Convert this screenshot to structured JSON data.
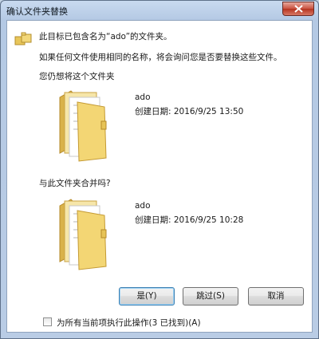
{
  "window": {
    "title": "确认文件夹替换"
  },
  "message": {
    "headline": "此目标已包含名为“ado”的文件夹。",
    "detail": "如果任何文件使用相同的名称，将会询问您是否要替换这些文件。",
    "prompt_move": "您仍想将这个文件夹",
    "prompt_merge": "与此文件夹合并吗?"
  },
  "source_folder": {
    "name": "ado",
    "created": "创建日期: 2016/9/25 13:50"
  },
  "target_folder": {
    "name": "ado",
    "created": "创建日期: 2016/9/25 10:28"
  },
  "buttons": {
    "yes": "是(Y)",
    "skip": "跳过(S)",
    "cancel": "取消"
  },
  "apply_all": {
    "label": "为所有当前项执行此操作(3 已找到)(A)",
    "checked": false
  }
}
